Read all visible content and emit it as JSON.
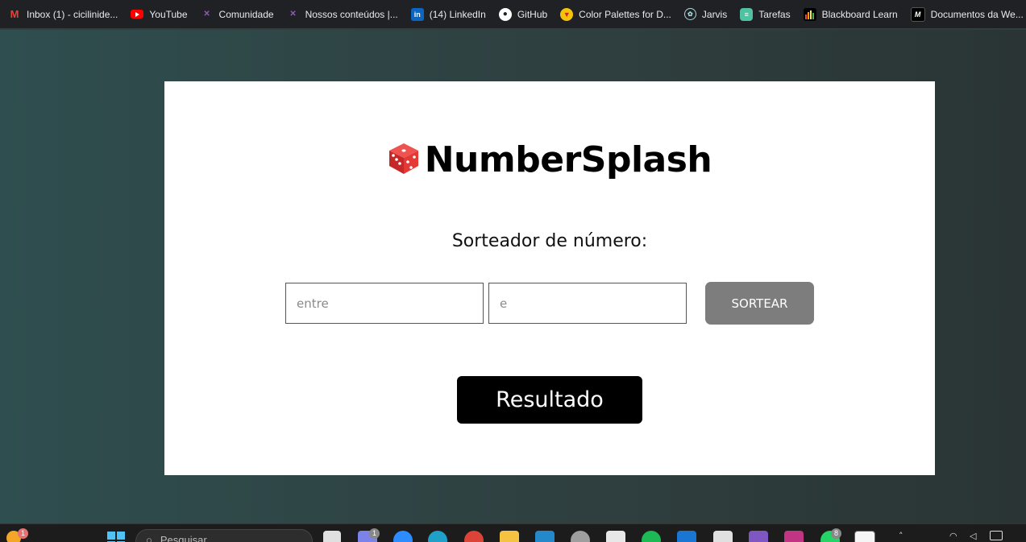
{
  "bookmarks": [
    {
      "label": "Inbox (1) - cicilinide...",
      "icon": "gmail-icon",
      "color": "#ea4335"
    },
    {
      "label": "YouTube",
      "icon": "youtube-icon",
      "color": "#ff0000"
    },
    {
      "label": "Comunidade",
      "icon": "community-icon",
      "color": "#7b3fa0"
    },
    {
      "label": "Nossos conteúdos |...",
      "icon": "content-icon",
      "color": "#7b3fa0"
    },
    {
      "label": "(14) LinkedIn",
      "icon": "linkedin-icon",
      "color": "#0a66c2"
    },
    {
      "label": "GitHub",
      "icon": "github-icon",
      "color": "#ffffff"
    },
    {
      "label": "Color Palettes for D...",
      "icon": "palette-icon",
      "color": "#f4c20d"
    },
    {
      "label": "Jarvis",
      "icon": "openai-icon",
      "color": "#10a37f"
    },
    {
      "label": "Tarefas",
      "icon": "tasks-icon",
      "color": "#4fc3a1"
    },
    {
      "label": "Blackboard Learn",
      "icon": "blackboard-icon",
      "color": "#ff9800"
    },
    {
      "label": "Documentos da We...",
      "icon": "docs-icon",
      "color": "#ffffff"
    }
  ],
  "app": {
    "title": "NumberSplash",
    "subtitle": "Sorteador de número:",
    "input_from_placeholder": "entre",
    "input_to_placeholder": "e",
    "draw_button_label": "SORTEAR",
    "result_label": "Resultado",
    "logo_icon": "dice-icon"
  },
  "taskbar": {
    "search_placeholder": "Pesquisar",
    "weather_badge": "1",
    "teams_badge": "1",
    "whatsapp_badge": "8"
  },
  "colors": {
    "accent_button": "#7d7d7d",
    "result_bg": "#000000",
    "dice": "#e53935"
  }
}
